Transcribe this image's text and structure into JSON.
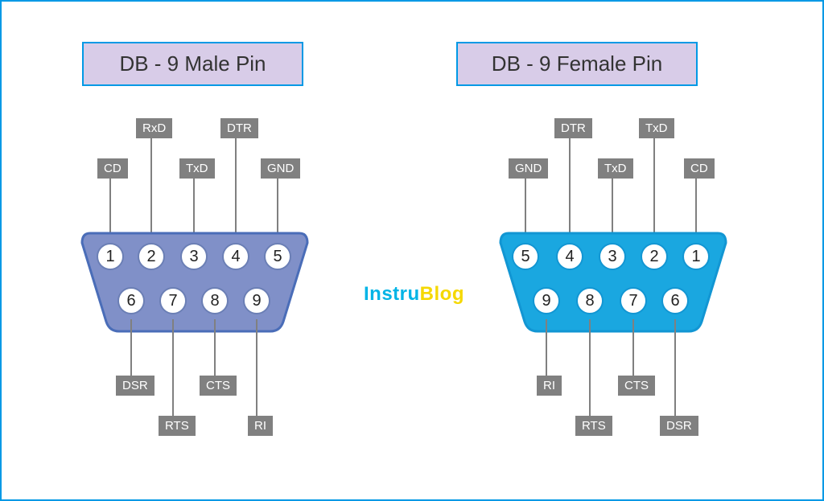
{
  "titles": {
    "male": "DB - 9 Male Pin",
    "female": "DB - 9 Female Pin"
  },
  "logo": {
    "part1": "Instru",
    "part2": "Blog"
  },
  "male": {
    "color": "#8090c8",
    "stroke": "#4a6db8",
    "top_labels": {
      "p1": "CD",
      "p2": "RxD",
      "p3": "TxD",
      "p4": "DTR",
      "p5": "GND"
    },
    "bottom_labels": {
      "p6": "DSR",
      "p7": "RTS",
      "p8": "CTS",
      "p9": "RI"
    },
    "pins_top": [
      "1",
      "2",
      "3",
      "4",
      "5"
    ],
    "pins_bot": [
      "6",
      "7",
      "8",
      "9"
    ]
  },
  "female": {
    "color": "#1aa7e0",
    "stroke": "#1296d3",
    "top_labels": {
      "p5": "GND",
      "p4": "DTR",
      "p3": "TxD",
      "p2": "TxD",
      "p1": "CD"
    },
    "bottom_labels": {
      "p9": "RI",
      "p8": "RTS",
      "p7": "CTS",
      "p6": "DSR"
    },
    "pins_top": [
      "5",
      "4",
      "3",
      "2",
      "1"
    ],
    "pins_bot": [
      "9",
      "8",
      "7",
      "6"
    ]
  }
}
